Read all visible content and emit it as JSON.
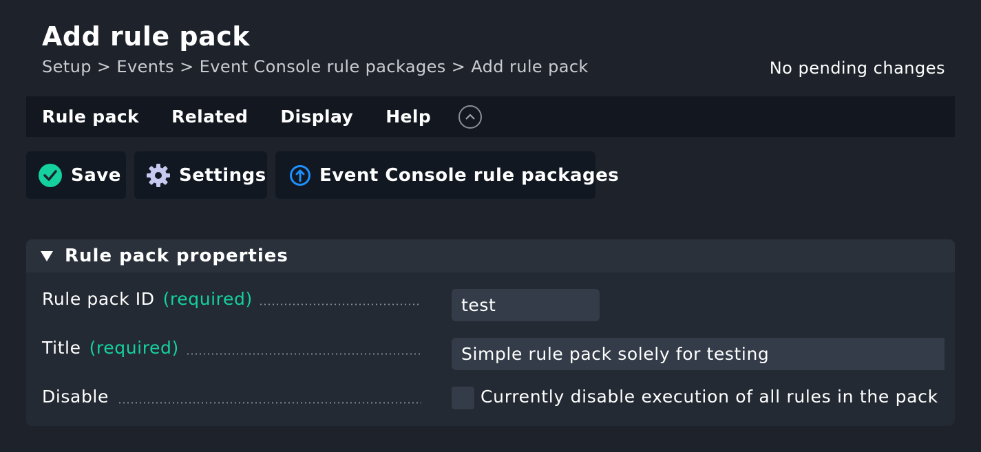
{
  "page": {
    "title": "Add rule pack",
    "pending": "No pending changes"
  },
  "breadcrumb": {
    "text": "Setup > Events > Event Console rule packages > Add rule pack"
  },
  "menu": {
    "items": [
      {
        "label": "Rule pack"
      },
      {
        "label": "Related"
      },
      {
        "label": "Display"
      },
      {
        "label": "Help"
      }
    ],
    "collapse_icon": "chevron-up-circle-icon"
  },
  "toolbar": {
    "save_label": "Save",
    "settings_label": "Settings",
    "ec_label": "Event Console rule packages",
    "save_color": "#15d1a0",
    "ec_color": "#1e90ff"
  },
  "panel": {
    "title": "Rule pack properties",
    "rows": [
      {
        "label": "Rule pack ID",
        "required": "(required)",
        "value": "test"
      },
      {
        "label": "Title",
        "required": "(required)",
        "value": "Simple rule pack solely for testing"
      },
      {
        "label": "Disable",
        "checkbox_label": "Currently disable execution of all rules in the pack",
        "checked": false
      }
    ]
  }
}
